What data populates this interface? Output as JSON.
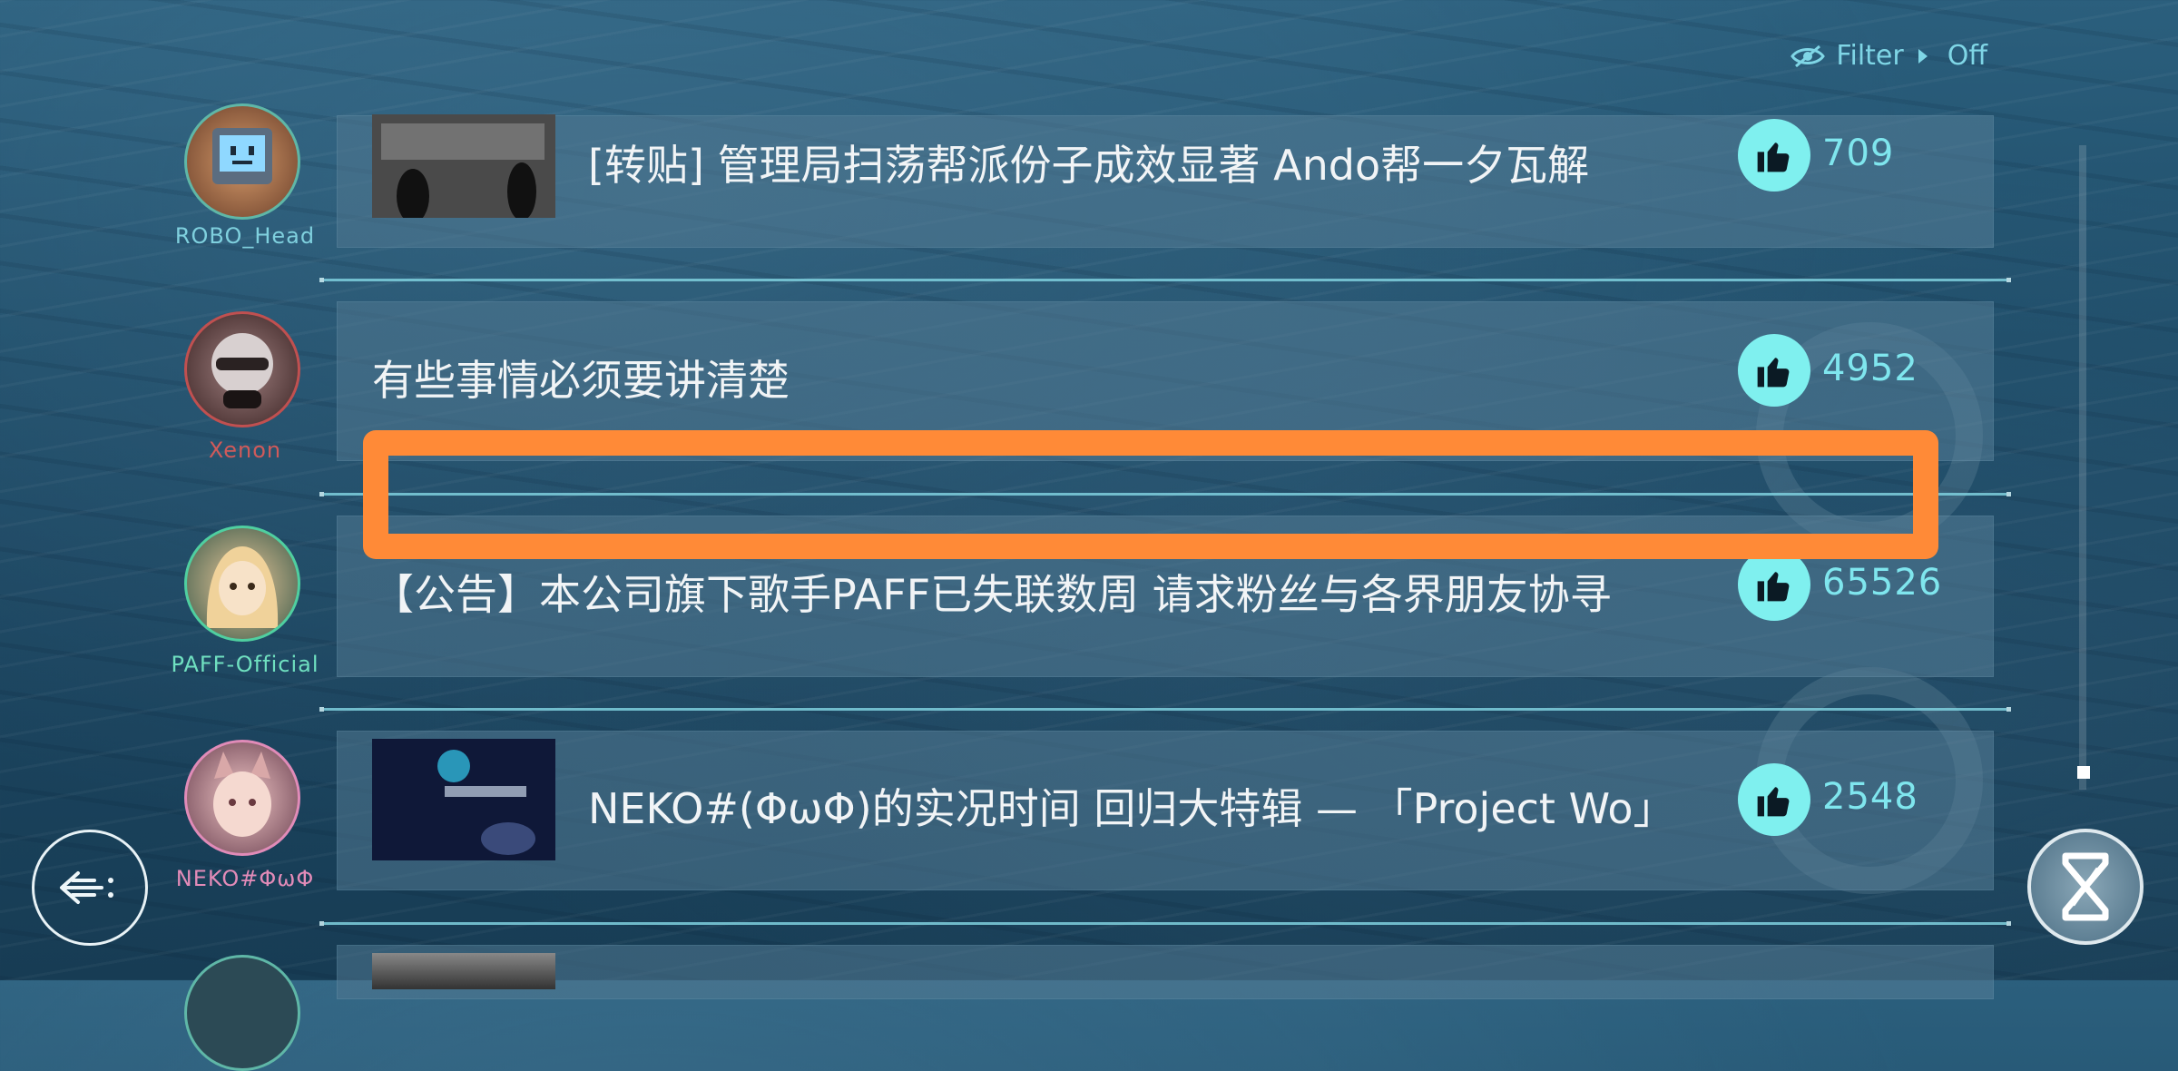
{
  "filter": {
    "label": "Filter",
    "value": "Off"
  },
  "posts": [
    {
      "username": "ROBO_Head",
      "username_color": "#7fd0de",
      "title": "[转贴] 管理局扫荡帮派份子成效显著 Ando帮一夕瓦解",
      "likes": "709",
      "has_thumbnail": true,
      "avatar_icon": "robo-head-avatar"
    },
    {
      "username": "Xenon",
      "username_color": "#d05a5a",
      "title": "有些事情必须要讲清楚",
      "likes": "4952",
      "has_thumbnail": false,
      "avatar_icon": "xenon-avatar"
    },
    {
      "username": "PAFF-Official",
      "username_color": "#6fe0c0",
      "title": "【公告】本公司旗下歌手PAFF已失联数周 请求粉丝与各界朋友协寻",
      "likes": "65526",
      "has_thumbnail": false,
      "avatar_icon": "paff-avatar"
    },
    {
      "username": "NEKO#ΦωΦ",
      "username_color": "#e28bb8",
      "title": "NEKO#(ΦωΦ)的实况时间 回归大特辑 — 「Project Wo」",
      "likes": "2548",
      "has_thumbnail": true,
      "avatar_icon": "neko-avatar"
    }
  ],
  "colors": {
    "accent": "#7ff0ef",
    "highlight": "#ff8a37"
  }
}
